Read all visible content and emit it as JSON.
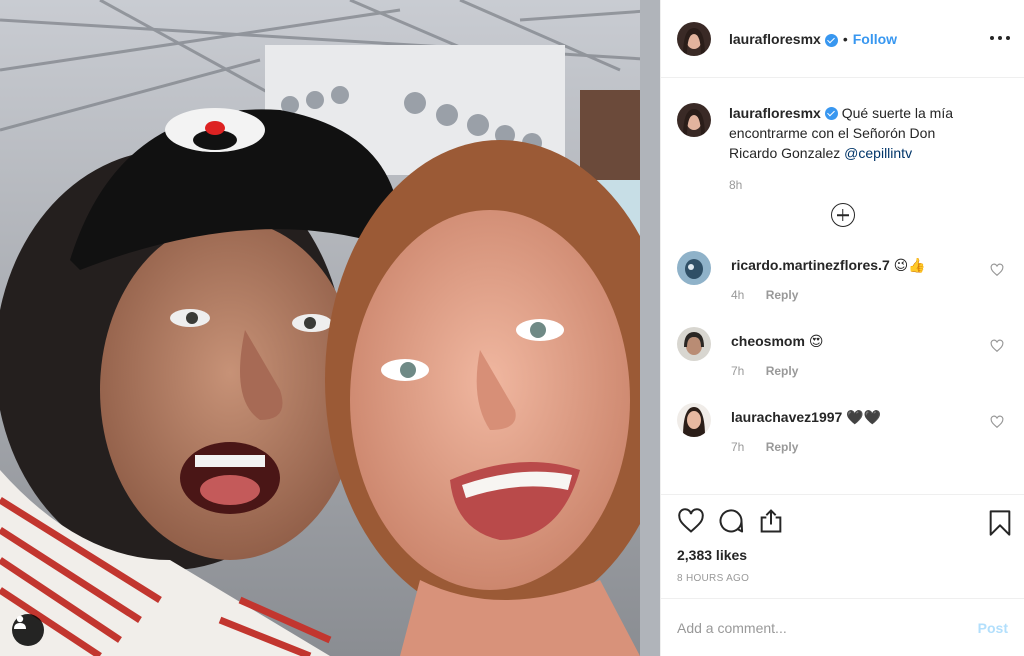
{
  "post": {
    "author": "laurafloresmx",
    "verified": true,
    "follow_label": "Follow",
    "separator": "•"
  },
  "caption": {
    "username": "laurafloresmx",
    "text": "Qué suerte la mía encontrarme con el Señorón Don Ricardo Gonzalez",
    "mention": "@cepillintv",
    "time": "8h"
  },
  "comments": [
    {
      "username": "ricardo.martinezflores.7",
      "text": "😉👍",
      "time": "4h",
      "reply": "Reply"
    },
    {
      "username": "cheosmom",
      "text": "😍",
      "time": "7h",
      "reply": "Reply"
    },
    {
      "username": "laurachavez1997",
      "text": "🖤🖤",
      "time": "7h",
      "reply": "Reply"
    }
  ],
  "footer": {
    "likes": "2,383 likes",
    "posted_ago": "8 HOURS AGO",
    "comment_placeholder": "Add a comment...",
    "post_label": "Post"
  },
  "colors": {
    "accent": "#3897f0",
    "post_disabled": "#b2dffc",
    "mention": "#003569"
  },
  "icons": [
    "user-tag-icon",
    "more-options-icon",
    "verified-badge-icon",
    "load-more-icon",
    "heart-icon",
    "comment-icon",
    "share-icon",
    "bookmark-icon"
  ]
}
